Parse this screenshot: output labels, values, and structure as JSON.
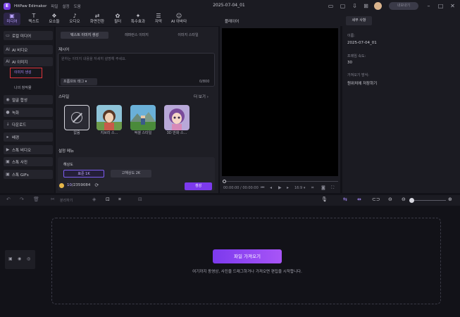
{
  "app": {
    "name": "HitPaw Edimakor",
    "logo_letter": "E",
    "menus": [
      "파일",
      "설정",
      "도움"
    ],
    "document_title": "2025-07-04_01",
    "export_label": "내보내기",
    "icons": [
      "panel-icon",
      "chat-icon",
      "share-icon",
      "layout-icon",
      "trophy-icon",
      "minimize-icon",
      "maximize-icon",
      "close-icon"
    ]
  },
  "toolbar": {
    "tabs": [
      {
        "label": "미디어",
        "icon": "folder-icon",
        "glyph": "▣",
        "active": true
      },
      {
        "label": "텍스트",
        "icon": "text-icon",
        "glyph": "T",
        "active": false
      },
      {
        "label": "요소들",
        "icon": "elements-icon",
        "glyph": "❖",
        "active": false
      },
      {
        "label": "오디오",
        "icon": "music-icon",
        "glyph": "♪",
        "active": false
      },
      {
        "label": "화면전환",
        "icon": "transition-icon",
        "glyph": "⇄",
        "active": false
      },
      {
        "label": "필터",
        "icon": "filter-icon",
        "glyph": "✿",
        "active": false
      },
      {
        "label": "특수효과",
        "icon": "effects-icon",
        "glyph": "✦",
        "active": false
      },
      {
        "label": "자막",
        "icon": "subtitle-icon",
        "glyph": "☰",
        "active": false
      },
      {
        "label": "AI 아바타",
        "icon": "avatar-icon",
        "glyph": "☺",
        "active": false
      }
    ]
  },
  "leftnav": {
    "items": [
      {
        "label": "로컬 미디어",
        "icon": "folder-icon",
        "glyph": "▭"
      },
      {
        "label": "AI 비디오",
        "icon": "ai-video-icon",
        "glyph": "AI"
      },
      {
        "label": "AI 이미지",
        "icon": "ai-image-icon",
        "glyph": "AI"
      },
      {
        "label": "얼굴 합성",
        "icon": "face-icon",
        "glyph": "◉"
      },
      {
        "label": "녹화",
        "icon": "record-icon",
        "glyph": "●"
      },
      {
        "label": "다운로드",
        "icon": "download-icon",
        "glyph": "↓"
      },
      {
        "label": "배경",
        "icon": "background-icon",
        "glyph": "▸"
      },
      {
        "label": "스톡 비디오",
        "icon": "stock-video-icon",
        "glyph": "▶"
      },
      {
        "label": "스톡 사진",
        "icon": "stock-photo-icon",
        "glyph": "▣"
      },
      {
        "label": "스톡 GIFs",
        "icon": "gif-icon",
        "glyph": "▣"
      }
    ],
    "sub_items": [
      "이미지 생성",
      "나의 창작물"
    ]
  },
  "center": {
    "subtabs": [
      "텍스트 이미지 생성",
      "레퍼런스 이미지",
      "이미지 스타일"
    ],
    "prompt_label": "제시어",
    "prompt_placeholder": "원하는 이미지 내용을 자세히 설명해 주세요.",
    "prompt_tag_label": "프롬프트 태그",
    "char_count": "0/800",
    "style_label": "스타일",
    "more_label": "더 보기",
    "styles": [
      "없음",
      "지브리 스...",
      "픽셀 스타일",
      "3D 만화 스..."
    ],
    "settings_label": "설정 메뉴",
    "resolution_label": "해상도",
    "res_1k": "표준 1K",
    "res_2k": "고해상도 2K",
    "credits_used": "10",
    "credits_total": "/2359084",
    "generate_label": "생성"
  },
  "player": {
    "title": "플레이어",
    "timecode": "00:00:00 / 00:00:00",
    "ratio": "16:9"
  },
  "details": {
    "tab": "세부 사항",
    "name_label": "이름:",
    "name_value": "2025-07-04_01",
    "fps_label": "프레임 속도:",
    "fps_value": "30",
    "import_mode_label": "가져오기 방식:",
    "import_mode_value": "원위치에 저장하기"
  },
  "timeline": {
    "split_label": "분리하기",
    "import_label": "파일 가져오기",
    "hint": "여기까지 동영상, 사진을 드래그하거나 가져오면 편집을 시작합니다."
  },
  "colors": {
    "accent": "#7c3aed",
    "accent_light": "#b9a3ff",
    "highlight_border": "#e0343a"
  }
}
